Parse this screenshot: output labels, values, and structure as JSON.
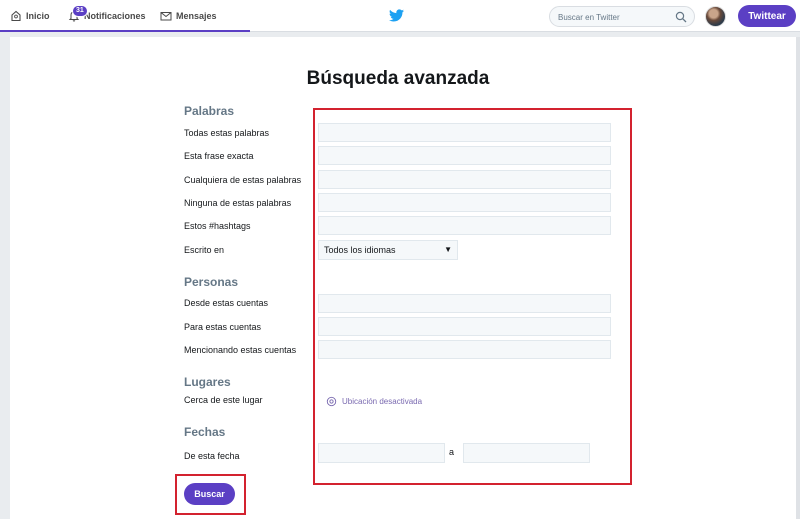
{
  "nav": {
    "home_label": "Inicio",
    "notifications_label": "Notificaciones",
    "notifications_count": "31",
    "messages_label": "Mensajes",
    "search_placeholder": "Buscar en Twitter",
    "tweet_button": "Twittear"
  },
  "page": {
    "title": "Búsqueda avanzada"
  },
  "sections": {
    "words": {
      "heading": "Palabras",
      "all_words": "Todas estas palabras",
      "exact_phrase": "Esta frase exacta",
      "any_words": "Cualquiera de estas palabras",
      "none_words": "Ninguna de estas palabras",
      "hashtags": "Estos #hashtags",
      "written_in": "Escrito en",
      "language_selected": "Todos los idiomas"
    },
    "people": {
      "heading": "Personas",
      "from_accounts": "Desde estas cuentas",
      "to_accounts": "Para estas cuentas",
      "mentioning": "Mencionando estas cuentas"
    },
    "places": {
      "heading": "Lugares",
      "near_place": "Cerca de este lugar",
      "location_status": "Ubicación desactivada"
    },
    "dates": {
      "heading": "Fechas",
      "from_date": "De esta fecha",
      "separator": "a"
    }
  },
  "actions": {
    "search_button": "Buscar"
  },
  "colors": {
    "accent": "#5b3fc4",
    "highlight": "#d3222f",
    "section_heading": "#657786"
  },
  "icons": {
    "home": "home-icon",
    "notifications": "bell-icon",
    "messages": "envelope-icon",
    "logo": "twitter-bird-icon",
    "search": "magnifier-icon",
    "location": "location-pin-icon"
  }
}
